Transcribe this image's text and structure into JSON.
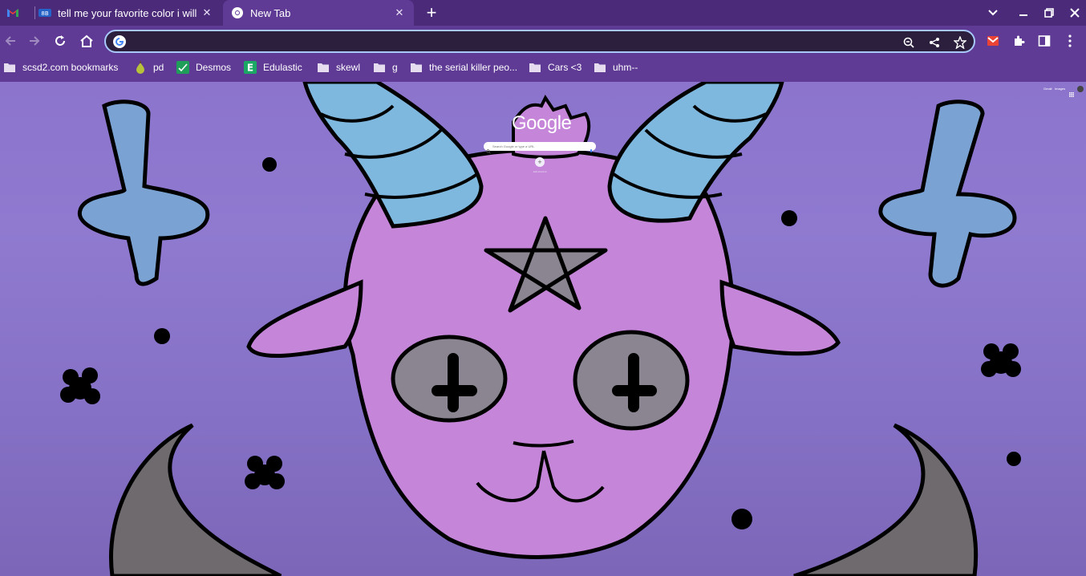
{
  "browser": {
    "tabs": [
      {
        "title": "tell me your favorite color i will n",
        "favicon": "quizlet-like-icon",
        "active": false
      },
      {
        "title": "New Tab",
        "favicon": "chrome-icon",
        "active": true
      }
    ],
    "omnibox": {
      "value": "",
      "placeholder": ""
    },
    "bookmarks": [
      {
        "label": "scsd2.com bookmarks",
        "icon": "folder-icon"
      },
      {
        "label": "pd",
        "icon": "pear-icon"
      },
      {
        "label": "Desmos",
        "icon": "desmos-icon"
      },
      {
        "label": "Edulastic",
        "icon": "edulastic-icon"
      },
      {
        "label": "skewl",
        "icon": "folder-icon"
      },
      {
        "label": "g",
        "icon": "folder-icon"
      },
      {
        "label": "the serial killer peo...",
        "icon": "folder-icon"
      },
      {
        "label": "Cars <3",
        "icon": "folder-icon"
      },
      {
        "label": "uhm--",
        "icon": "folder-icon"
      }
    ]
  },
  "ntp": {
    "logo": "Google",
    "search_placeholder": "Search Google or type a URL",
    "shortcut_label": "Add shortcut",
    "top_links": [
      "Gmail",
      "Images"
    ]
  },
  "colors": {
    "tabstrip": "#4b2a7a",
    "toolbar": "#5f3b95",
    "omnibox_border": "#a8c7fa",
    "face_pink": "#c585d8",
    "horn_blue": "#7fb8de",
    "cross_blue": "#7aa3d4",
    "moon_gray": "#6e6a6e",
    "star_gray": "#8a8590"
  }
}
